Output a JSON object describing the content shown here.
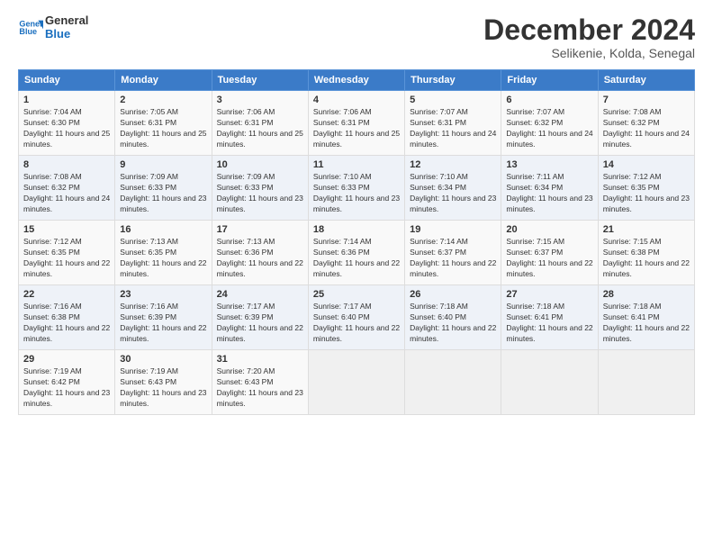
{
  "logo": {
    "line1": "General",
    "line2": "Blue"
  },
  "title": "December 2024",
  "subtitle": "Selikenie, Kolda, Senegal",
  "days_header": [
    "Sunday",
    "Monday",
    "Tuesday",
    "Wednesday",
    "Thursday",
    "Friday",
    "Saturday"
  ],
  "weeks": [
    [
      {
        "day": "1",
        "sunrise": "7:04 AM",
        "sunset": "6:30 PM",
        "daylight": "11 hours and 25 minutes."
      },
      {
        "day": "2",
        "sunrise": "7:05 AM",
        "sunset": "6:31 PM",
        "daylight": "11 hours and 25 minutes."
      },
      {
        "day": "3",
        "sunrise": "7:06 AM",
        "sunset": "6:31 PM",
        "daylight": "11 hours and 25 minutes."
      },
      {
        "day": "4",
        "sunrise": "7:06 AM",
        "sunset": "6:31 PM",
        "daylight": "11 hours and 25 minutes."
      },
      {
        "day": "5",
        "sunrise": "7:07 AM",
        "sunset": "6:31 PM",
        "daylight": "11 hours and 24 minutes."
      },
      {
        "day": "6",
        "sunrise": "7:07 AM",
        "sunset": "6:32 PM",
        "daylight": "11 hours and 24 minutes."
      },
      {
        "day": "7",
        "sunrise": "7:08 AM",
        "sunset": "6:32 PM",
        "daylight": "11 hours and 24 minutes."
      }
    ],
    [
      {
        "day": "8",
        "sunrise": "7:08 AM",
        "sunset": "6:32 PM",
        "daylight": "11 hours and 24 minutes."
      },
      {
        "day": "9",
        "sunrise": "7:09 AM",
        "sunset": "6:33 PM",
        "daylight": "11 hours and 23 minutes."
      },
      {
        "day": "10",
        "sunrise": "7:09 AM",
        "sunset": "6:33 PM",
        "daylight": "11 hours and 23 minutes."
      },
      {
        "day": "11",
        "sunrise": "7:10 AM",
        "sunset": "6:33 PM",
        "daylight": "11 hours and 23 minutes."
      },
      {
        "day": "12",
        "sunrise": "7:10 AM",
        "sunset": "6:34 PM",
        "daylight": "11 hours and 23 minutes."
      },
      {
        "day": "13",
        "sunrise": "7:11 AM",
        "sunset": "6:34 PM",
        "daylight": "11 hours and 23 minutes."
      },
      {
        "day": "14",
        "sunrise": "7:12 AM",
        "sunset": "6:35 PM",
        "daylight": "11 hours and 23 minutes."
      }
    ],
    [
      {
        "day": "15",
        "sunrise": "7:12 AM",
        "sunset": "6:35 PM",
        "daylight": "11 hours and 22 minutes."
      },
      {
        "day": "16",
        "sunrise": "7:13 AM",
        "sunset": "6:35 PM",
        "daylight": "11 hours and 22 minutes."
      },
      {
        "day": "17",
        "sunrise": "7:13 AM",
        "sunset": "6:36 PM",
        "daylight": "11 hours and 22 minutes."
      },
      {
        "day": "18",
        "sunrise": "7:14 AM",
        "sunset": "6:36 PM",
        "daylight": "11 hours and 22 minutes."
      },
      {
        "day": "19",
        "sunrise": "7:14 AM",
        "sunset": "6:37 PM",
        "daylight": "11 hours and 22 minutes."
      },
      {
        "day": "20",
        "sunrise": "7:15 AM",
        "sunset": "6:37 PM",
        "daylight": "11 hours and 22 minutes."
      },
      {
        "day": "21",
        "sunrise": "7:15 AM",
        "sunset": "6:38 PM",
        "daylight": "11 hours and 22 minutes."
      }
    ],
    [
      {
        "day": "22",
        "sunrise": "7:16 AM",
        "sunset": "6:38 PM",
        "daylight": "11 hours and 22 minutes."
      },
      {
        "day": "23",
        "sunrise": "7:16 AM",
        "sunset": "6:39 PM",
        "daylight": "11 hours and 22 minutes."
      },
      {
        "day": "24",
        "sunrise": "7:17 AM",
        "sunset": "6:39 PM",
        "daylight": "11 hours and 22 minutes."
      },
      {
        "day": "25",
        "sunrise": "7:17 AM",
        "sunset": "6:40 PM",
        "daylight": "11 hours and 22 minutes."
      },
      {
        "day": "26",
        "sunrise": "7:18 AM",
        "sunset": "6:40 PM",
        "daylight": "11 hours and 22 minutes."
      },
      {
        "day": "27",
        "sunrise": "7:18 AM",
        "sunset": "6:41 PM",
        "daylight": "11 hours and 22 minutes."
      },
      {
        "day": "28",
        "sunrise": "7:18 AM",
        "sunset": "6:41 PM",
        "daylight": "11 hours and 22 minutes."
      }
    ],
    [
      {
        "day": "29",
        "sunrise": "7:19 AM",
        "sunset": "6:42 PM",
        "daylight": "11 hours and 23 minutes."
      },
      {
        "day": "30",
        "sunrise": "7:19 AM",
        "sunset": "6:43 PM",
        "daylight": "11 hours and 23 minutes."
      },
      {
        "day": "31",
        "sunrise": "7:20 AM",
        "sunset": "6:43 PM",
        "daylight": "11 hours and 23 minutes."
      },
      null,
      null,
      null,
      null
    ]
  ]
}
